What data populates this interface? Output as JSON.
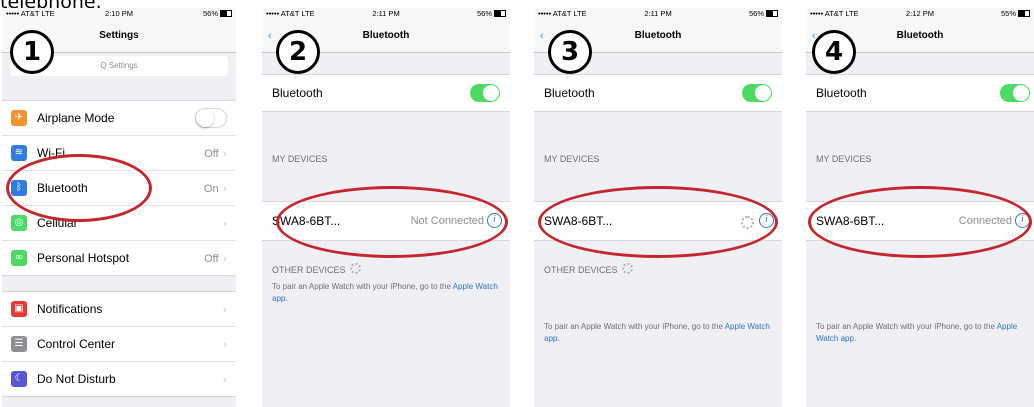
{
  "caption": "telephone.",
  "panels": [
    {
      "step": "1",
      "status": {
        "carrier": "••••• AT&T LTE",
        "time": "2:10 PM",
        "battery": "56%"
      },
      "title": "Settings",
      "search_placeholder": "Q Settings",
      "group1": [
        {
          "label": "Airplane Mode",
          "icon_color": "#f1932f",
          "icon": "airplane-icon",
          "glyph": "✈",
          "control": "switch-off"
        },
        {
          "label": "Wi-Fi",
          "icon_color": "#2f7de1",
          "icon": "wifi-icon",
          "glyph": "≋",
          "value": "Off"
        },
        {
          "label": "Bluetooth",
          "icon_color": "#2f7de1",
          "icon": "bluetooth-icon",
          "glyph": "ᛒ",
          "value": "On"
        },
        {
          "label": "Cellular",
          "icon_color": "#4cd964",
          "icon": "cellular-icon",
          "glyph": "◎",
          "value": ""
        },
        {
          "label": "Personal Hotspot",
          "icon_color": "#4cd964",
          "icon": "hotspot-icon",
          "glyph": "∞",
          "value": "Off"
        }
      ],
      "group2": [
        {
          "label": "Notifications",
          "icon_color": "#e8393a",
          "icon": "notifications-icon",
          "glyph": "▣"
        },
        {
          "label": "Control Center",
          "icon_color": "#8e8e93",
          "icon": "control-center-icon",
          "glyph": "☰"
        },
        {
          "label": "Do Not Disturb",
          "icon_color": "#5856d6",
          "icon": "moon-icon",
          "glyph": "☾"
        }
      ]
    },
    {
      "step": "2",
      "status": {
        "carrier": "••••• AT&T LTE",
        "time": "2:11 PM",
        "battery": "56%"
      },
      "title": "Bluetooth",
      "bluetooth_label": "Bluetooth",
      "my_devices": "MY DEVICES",
      "device_name": "SWA8-6BT...",
      "device_status": "Not Connected",
      "other_devices": "OTHER DEVICES",
      "help_text": "To pair an Apple Watch with your iPhone, go to the",
      "help_link": "Apple Watch app."
    },
    {
      "step": "3",
      "status": {
        "carrier": "••••• AT&T LTE",
        "time": "2:11 PM",
        "battery": "56%"
      },
      "title": "Bluetooth",
      "bluetooth_label": "Bluetooth",
      "my_devices": "MY DEVICES",
      "device_name": "SWA8-6BT...",
      "other_devices": "OTHER DEVICES",
      "help_text": "To pair an Apple Watch with your iPhone, go to the",
      "help_link": "Apple Watch app."
    },
    {
      "step": "4",
      "status": {
        "carrier": "••••• AT&T LTE",
        "time": "2:12 PM",
        "battery": "55%"
      },
      "title": "Bluetooth",
      "bluetooth_label": "Bluetooth",
      "my_devices": "MY DEVICES",
      "device_name": "SWA8-6BT...",
      "device_status": "Connected",
      "help_text": "To pair an Apple Watch with your iPhone, go to the",
      "help_link": "Apple Watch app."
    }
  ],
  "colors": {
    "highlight_ring": "#c4262e",
    "switch_on": "#4cd964",
    "link": "#2e74c4"
  }
}
